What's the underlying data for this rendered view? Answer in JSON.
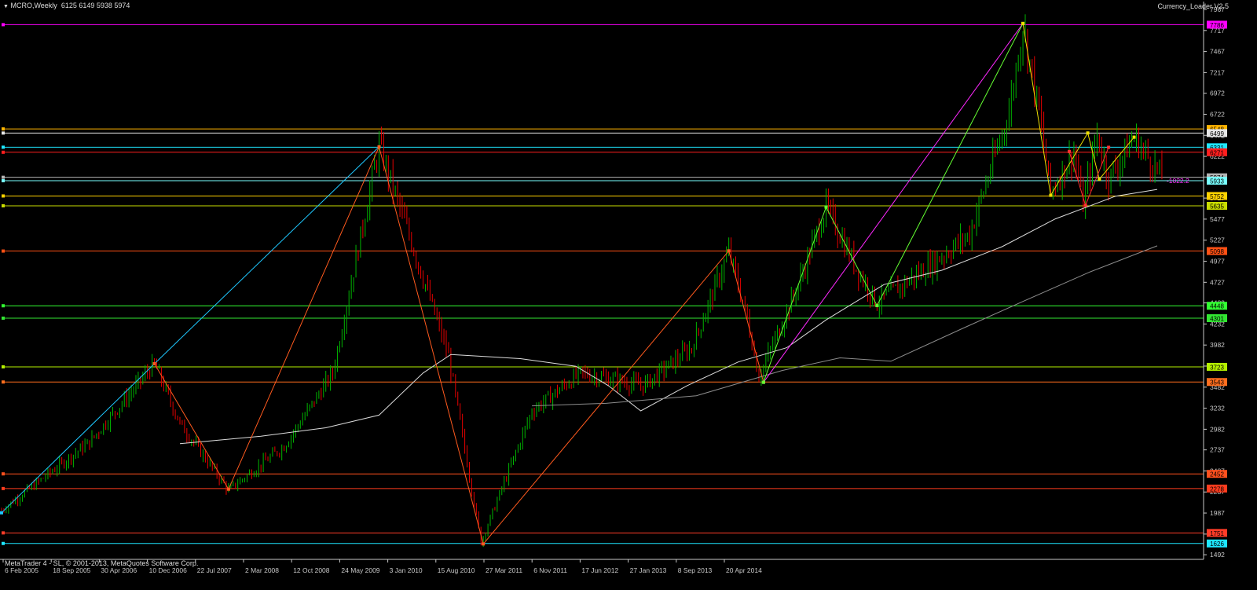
{
  "header": {
    "symbol": "MCRO,Weekly",
    "ohlc": "6125 6149 5938 5974",
    "indicator": "Currency_Loader V2.5",
    "copyright": "MetaTrader 4 - SL, © 2001-2013, MetaQuotes Software Corp."
  },
  "colors": {
    "background": "#000000",
    "axis": "#c8c8c8",
    "bull_candle": "#00b400",
    "bear_candle": "#e60000",
    "ma_fast": "#dcdcdc",
    "ma_slow": "#8c8c8c"
  },
  "chart_data": {
    "type": "candlestick",
    "symbol": "MCRO",
    "timeframe": "Weekly",
    "ylim": [
      1437,
      7967
    ],
    "y_ticks": [
      7967,
      7717,
      7467,
      7217,
      6972,
      6722,
      6472,
      6222,
      5977,
      5727,
      5477,
      5227,
      4977,
      4727,
      4482,
      4232,
      3982,
      3732,
      3482,
      3232,
      2982,
      2737,
      2487,
      2237,
      1987,
      1737,
      1492
    ],
    "x_ticks": [
      "6 Feb 2005",
      "18 Sep 2005",
      "30 Apr 2006",
      "10 Dec 2006",
      "22 Jul 2007",
      "2 Mar 2008",
      "12 Oct 2008",
      "24 May 2009",
      "3 Jan 2010",
      "15 Aug 2010",
      "27 Mar 2011",
      "6 Nov 2011",
      "17 Jun 2012",
      "27 Jan 2013",
      "8 Sep 2013",
      "20 Apr 2014"
    ],
    "x_range": [
      "2005-02-06",
      "2015-01-18"
    ],
    "last_bar_date": "2014-09-14",
    "current": {
      "open": 6125,
      "high": 6149,
      "low": 5938,
      "close": 5974
    },
    "price_path": [
      [
        "2005-02-06",
        2020
      ],
      [
        "2005-10-30",
        2830
      ],
      [
        "2006-05-14",
        3760
      ],
      [
        "2006-07-30",
        3050
      ],
      [
        "2006-12-24",
        2260
      ],
      [
        "2007-06-10",
        2780
      ],
      [
        "2007-11-04",
        3650
      ],
      [
        "2008-03-23",
        6350
      ],
      [
        "2008-06-29",
        5200
      ],
      [
        "2008-10-19",
        3850
      ],
      [
        "2009-01-25",
        1640
      ],
      [
        "2009-06-28",
        3200
      ],
      [
        "2009-11-22",
        3650
      ],
      [
        "2010-05-30",
        3500
      ],
      [
        "2010-10-24",
        3950
      ],
      [
        "2011-02-13",
        5090
      ],
      [
        "2011-04-10",
        4300
      ],
      [
        "2011-05-15",
        3600
      ],
      [
        "2011-09-11",
        4700
      ],
      [
        "2011-12-04",
        5620
      ],
      [
        "2012-03-04",
        4900
      ],
      [
        "2012-05-06",
        4480
      ],
      [
        "2012-10-21",
        4950
      ],
      [
        "2013-02-10",
        5300
      ],
      [
        "2013-06-09",
        6750
      ],
      [
        "2013-07-21",
        7780
      ],
      [
        "2013-09-08",
        6750
      ],
      [
        "2013-10-13",
        5800
      ],
      [
        "2013-12-22",
        6270
      ],
      [
        "2014-01-19",
        5650
      ],
      [
        "2014-03-02",
        6480
      ],
      [
        "2014-04-06",
        5950
      ],
      [
        "2014-06-22",
        6450
      ],
      [
        "2014-09-14",
        5974
      ]
    ],
    "moving_averages": [
      {
        "points": [
          [
            "2006-07-30",
            2810
          ],
          [
            "2007-04-01",
            2900
          ],
          [
            "2007-10-14",
            3000
          ],
          [
            "2008-03-23",
            3150
          ],
          [
            "2008-08-03",
            3650
          ],
          [
            "2008-10-26",
            3870
          ],
          [
            "2009-05-24",
            3820
          ],
          [
            "2009-11-08",
            3730
          ],
          [
            "2010-02-14",
            3500
          ],
          [
            "2010-05-23",
            3200
          ],
          [
            "2010-10-10",
            3500
          ],
          [
            "2011-03-13",
            3780
          ],
          [
            "2011-08-07",
            3950
          ],
          [
            "2011-12-04",
            4280
          ],
          [
            "2012-05-27",
            4700
          ],
          [
            "2012-11-18",
            4870
          ],
          [
            "2013-05-19",
            5150
          ],
          [
            "2013-10-27",
            5480
          ],
          [
            "2014-04-27",
            5750
          ],
          [
            "2014-08-31",
            5830
          ]
        ]
      },
      {
        "points": [
          [
            "2009-06-28",
            3260
          ],
          [
            "2010-02-07",
            3290
          ],
          [
            "2010-11-07",
            3380
          ],
          [
            "2011-07-24",
            3680
          ],
          [
            "2012-01-15",
            3830
          ],
          [
            "2012-06-17",
            3790
          ],
          [
            "2013-01-20",
            4180
          ],
          [
            "2013-07-21",
            4500
          ],
          [
            "2014-02-09",
            4850
          ],
          [
            "2014-08-31",
            5160
          ]
        ]
      }
    ],
    "zigzag_lines": [
      {
        "color": "#1ec8ff",
        "points": [
          [
            "2005-02-06",
            1990
          ],
          [
            "2006-05-14",
            3760
          ],
          [
            "2008-03-23",
            6335
          ]
        ]
      },
      {
        "color": "#ff5a1e",
        "points": [
          [
            "2006-05-14",
            3760
          ],
          [
            "2006-12-24",
            2270
          ],
          [
            "2008-03-23",
            6335
          ],
          [
            "2009-02-01",
            1620
          ],
          [
            "2011-02-13",
            5100
          ],
          [
            "2011-05-29",
            3540
          ]
        ]
      },
      {
        "color": "#ff28ff",
        "points": [
          [
            "2011-05-29",
            3540
          ],
          [
            "2013-07-21",
            7800
          ]
        ]
      },
      {
        "color": "#64ff32",
        "points": [
          [
            "2011-05-29",
            3540
          ],
          [
            "2011-12-04",
            5620
          ],
          [
            "2012-05-06",
            4450
          ],
          [
            "2013-07-21",
            7800
          ]
        ]
      },
      {
        "color": "#f0e000",
        "points": [
          [
            "2013-07-21",
            7800
          ],
          [
            "2013-10-13",
            5760
          ],
          [
            "2014-02-02",
            6500
          ],
          [
            "2014-03-09",
            5950
          ],
          [
            "2014-06-22",
            6450
          ]
        ]
      },
      {
        "color": "#ff3030",
        "points": [
          [
            "2013-12-08",
            6280
          ],
          [
            "2014-01-26",
            5640
          ],
          [
            "2014-04-06",
            6330
          ]
        ]
      }
    ],
    "horizontal_levels": [
      {
        "value": 7786,
        "label": "7786",
        "color": "#ff00ff"
      },
      {
        "value": 6548,
        "label": "6548",
        "color": "#ffb400"
      },
      {
        "value": 6499,
        "label": "6499",
        "color": "#e6e6e6"
      },
      {
        "value": 6331,
        "label": "6331",
        "color": "#1ee6ff"
      },
      {
        "value": 6271,
        "label": "6271",
        "color": "#ff1e1e"
      },
      {
        "value": 5974,
        "label": "5974",
        "color": "#b4b4b4"
      },
      {
        "value": 5933,
        "label": "5933",
        "color": "#78ffff"
      },
      {
        "value": 5752,
        "label": "5752",
        "color": "#ffd200"
      },
      {
        "value": 5635,
        "label": "5635",
        "color": "#c8dc00"
      },
      {
        "value": 5098,
        "label": "5098",
        "color": "#ff5014"
      },
      {
        "value": 4448,
        "label": "4448",
        "color": "#32ff32"
      },
      {
        "value": 4301,
        "label": "4301",
        "color": "#32e632"
      },
      {
        "value": 3723,
        "label": "3723",
        "color": "#b4f000"
      },
      {
        "value": 3543,
        "label": "3543",
        "color": "#ff6e1e"
      },
      {
        "value": 2452,
        "label": "2452",
        "color": "#ff501e"
      },
      {
        "value": 2278,
        "label": "2278",
        "color": "#ff3c1e"
      },
      {
        "value": 1751,
        "label": "1751",
        "color": "#ff3c28"
      },
      {
        "value": 1626,
        "label": "1626",
        "color": "#1ee6ff"
      }
    ],
    "annotations": [
      {
        "text": "-1022.2",
        "date": "2014-09-14",
        "value": 5935,
        "color": "#ff32ff"
      }
    ]
  }
}
